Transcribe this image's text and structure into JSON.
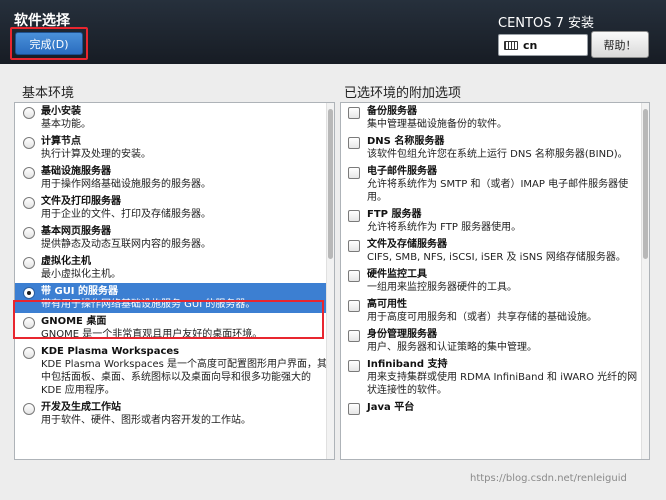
{
  "header": {
    "title": "软件选择",
    "done_label": "完成(D)",
    "install_title": "CENTOS 7 安装",
    "keyboard_layout": "cn",
    "help_label": "帮助！"
  },
  "base_environment": {
    "title": "基本环境",
    "items": [
      {
        "name": "最小安装",
        "desc": "基本功能。",
        "selected": false
      },
      {
        "name": "计算节点",
        "desc": "执行计算及处理的安装。",
        "selected": false
      },
      {
        "name": "基础设施服务器",
        "desc": "用于操作网络基础设施服务的服务器。",
        "selected": false
      },
      {
        "name": "文件及打印服务器",
        "desc": "用于企业的文件、打印及存储服务器。",
        "selected": false
      },
      {
        "name": "基本网页服务器",
        "desc": "提供静态及动态互联网内容的服务器。",
        "selected": false
      },
      {
        "name": "虚拟化主机",
        "desc": "最小虚拟化主机。",
        "selected": false
      },
      {
        "name": "带 GUI 的服务器",
        "desc": "带有用于操作网络基础设施服务 GUI 的服务器。",
        "selected": true
      },
      {
        "name": "GNOME 桌面",
        "desc": "GNOME 是一个非常直观且用户友好的桌面环境。",
        "selected": false
      },
      {
        "name": "KDE Plasma Workspaces",
        "desc": "KDE Plasma Workspaces 是一个高度可配置图形用户界面，其中包括面板、桌面、系统图标以及桌面向导和很多功能强大的 KDE 应用程序。",
        "selected": false
      },
      {
        "name": "开发及生成工作站",
        "desc": "用于软件、硬件、图形或者内容开发的工作站。",
        "selected": false
      }
    ]
  },
  "addons": {
    "title": "已选环境的附加选项",
    "items": [
      {
        "name": "备份服务器",
        "desc": "集中管理基础设施备份的软件。"
      },
      {
        "name": "DNS 名称服务器",
        "desc": "该软件包组允许您在系统上运行 DNS 名称服务器(BIND)。"
      },
      {
        "name": "电子邮件服务器",
        "desc": "允许将系统作为 SMTP 和（或者）IMAP 电子邮件服务器使用。"
      },
      {
        "name": "FTP 服务器",
        "desc": "允许将系统作为 FTP 服务器使用。"
      },
      {
        "name": "文件及存储服务器",
        "desc": "CIFS, SMB, NFS, iSCSI, iSER 及 iSNS 网络存储服务器。"
      },
      {
        "name": "硬件监控工具",
        "desc": "一组用来监控服务器硬件的工具。"
      },
      {
        "name": "高可用性",
        "desc": "用于高度可用服务和（或者）共享存储的基础设施。"
      },
      {
        "name": "身份管理服务器",
        "desc": "用户、服务器和认证策略的集中管理。"
      },
      {
        "name": "Infiniband 支持",
        "desc": "用来支持集群或使用 RDMA InfiniBand 和 iWARO 光纤的网状连接性的软件。"
      },
      {
        "name": "Java 平台",
        "desc": ""
      }
    ]
  },
  "watermark": "https://blog.csdn.net/renleiguid",
  "colors": {
    "selection": "#3c7fd2",
    "highlight_border": "#e8262f",
    "header_bg": "#1d232c"
  }
}
